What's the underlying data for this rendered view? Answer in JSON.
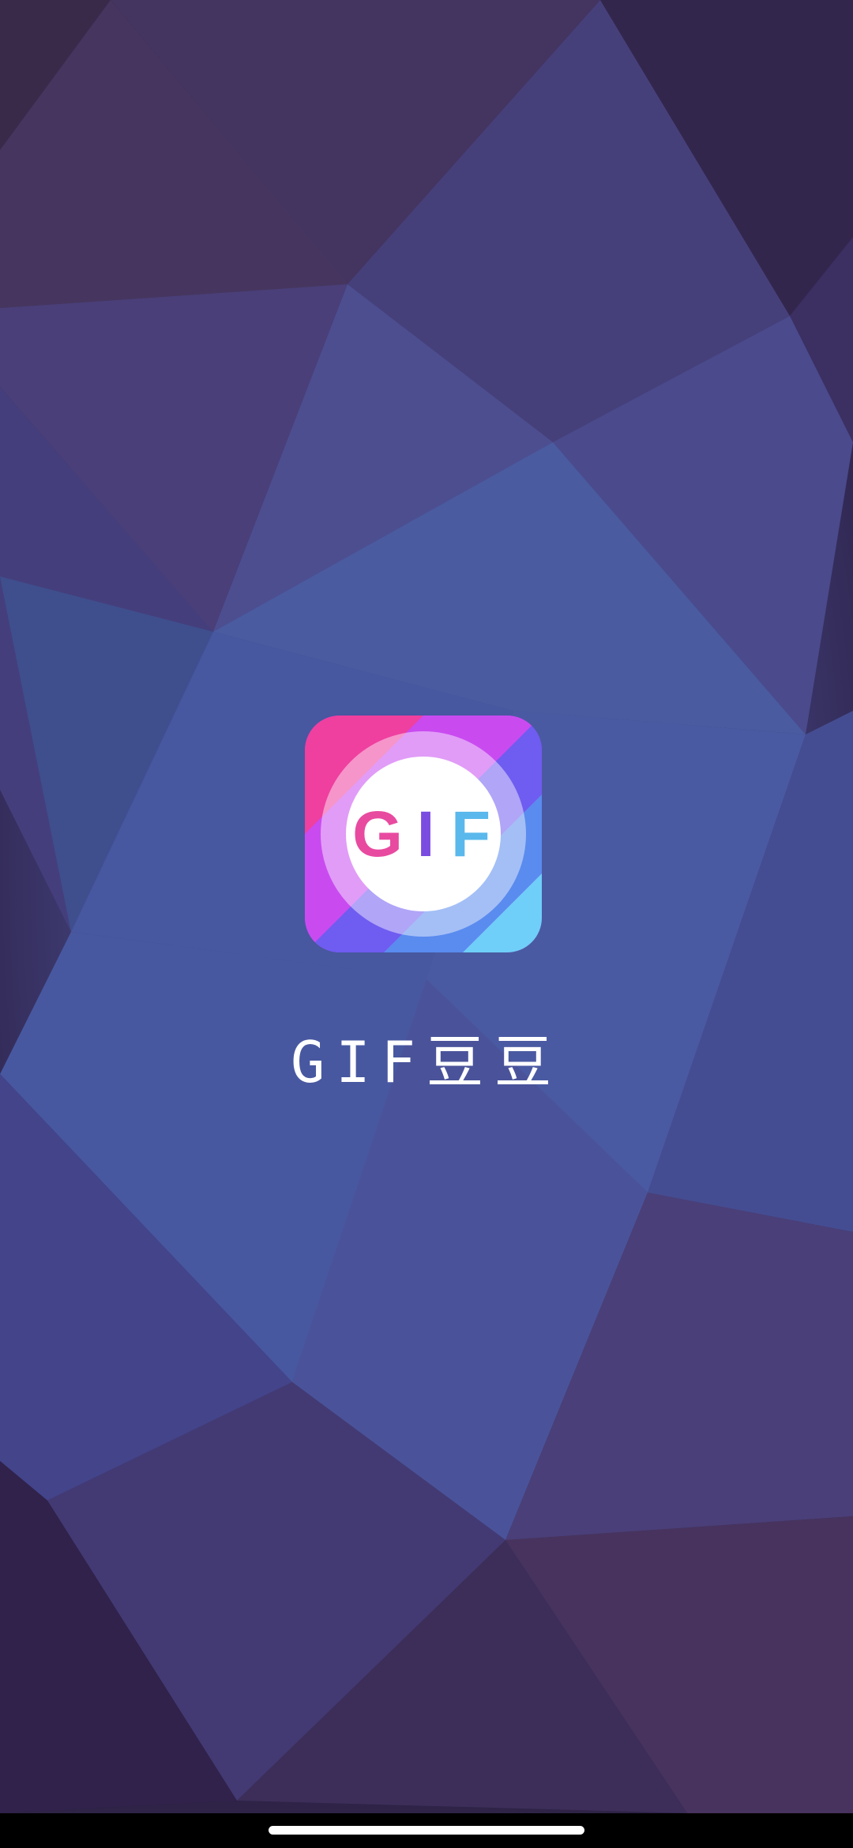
{
  "splash": {
    "app_name": "GIF豆豆",
    "icon": {
      "name": "gif-app-icon",
      "letters": [
        "G",
        "I",
        "F"
      ],
      "letter_colors": [
        "#e84aa0",
        "#7a4ce0",
        "#5ab8ec"
      ]
    }
  },
  "system": {
    "home_indicator": "home-indicator"
  },
  "colors": {
    "background_dark": "#2f2450",
    "background_mid": "#4a5aa0",
    "accent_pink": "#ef3fa0",
    "accent_purple": "#a64cf2",
    "accent_blue": "#5a8ef0",
    "accent_cyan": "#6fd0f8"
  }
}
